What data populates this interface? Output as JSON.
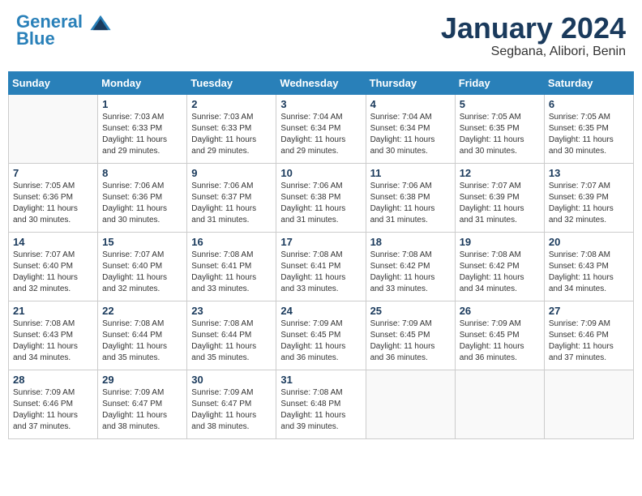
{
  "header": {
    "logo_line1": "General",
    "logo_line2": "Blue",
    "month": "January 2024",
    "location": "Segbana, Alibori, Benin"
  },
  "weekdays": [
    "Sunday",
    "Monday",
    "Tuesday",
    "Wednesday",
    "Thursday",
    "Friday",
    "Saturday"
  ],
  "weeks": [
    [
      {
        "day": "",
        "detail": ""
      },
      {
        "day": "1",
        "detail": "Sunrise: 7:03 AM\nSunset: 6:33 PM\nDaylight: 11 hours\nand 29 minutes."
      },
      {
        "day": "2",
        "detail": "Sunrise: 7:03 AM\nSunset: 6:33 PM\nDaylight: 11 hours\nand 29 minutes."
      },
      {
        "day": "3",
        "detail": "Sunrise: 7:04 AM\nSunset: 6:34 PM\nDaylight: 11 hours\nand 29 minutes."
      },
      {
        "day": "4",
        "detail": "Sunrise: 7:04 AM\nSunset: 6:34 PM\nDaylight: 11 hours\nand 30 minutes."
      },
      {
        "day": "5",
        "detail": "Sunrise: 7:05 AM\nSunset: 6:35 PM\nDaylight: 11 hours\nand 30 minutes."
      },
      {
        "day": "6",
        "detail": "Sunrise: 7:05 AM\nSunset: 6:35 PM\nDaylight: 11 hours\nand 30 minutes."
      }
    ],
    [
      {
        "day": "7",
        "detail": "Sunrise: 7:05 AM\nSunset: 6:36 PM\nDaylight: 11 hours\nand 30 minutes."
      },
      {
        "day": "8",
        "detail": "Sunrise: 7:06 AM\nSunset: 6:36 PM\nDaylight: 11 hours\nand 30 minutes."
      },
      {
        "day": "9",
        "detail": "Sunrise: 7:06 AM\nSunset: 6:37 PM\nDaylight: 11 hours\nand 31 minutes."
      },
      {
        "day": "10",
        "detail": "Sunrise: 7:06 AM\nSunset: 6:38 PM\nDaylight: 11 hours\nand 31 minutes."
      },
      {
        "day": "11",
        "detail": "Sunrise: 7:06 AM\nSunset: 6:38 PM\nDaylight: 11 hours\nand 31 minutes."
      },
      {
        "day": "12",
        "detail": "Sunrise: 7:07 AM\nSunset: 6:39 PM\nDaylight: 11 hours\nand 31 minutes."
      },
      {
        "day": "13",
        "detail": "Sunrise: 7:07 AM\nSunset: 6:39 PM\nDaylight: 11 hours\nand 32 minutes."
      }
    ],
    [
      {
        "day": "14",
        "detail": "Sunrise: 7:07 AM\nSunset: 6:40 PM\nDaylight: 11 hours\nand 32 minutes."
      },
      {
        "day": "15",
        "detail": "Sunrise: 7:07 AM\nSunset: 6:40 PM\nDaylight: 11 hours\nand 32 minutes."
      },
      {
        "day": "16",
        "detail": "Sunrise: 7:08 AM\nSunset: 6:41 PM\nDaylight: 11 hours\nand 33 minutes."
      },
      {
        "day": "17",
        "detail": "Sunrise: 7:08 AM\nSunset: 6:41 PM\nDaylight: 11 hours\nand 33 minutes."
      },
      {
        "day": "18",
        "detail": "Sunrise: 7:08 AM\nSunset: 6:42 PM\nDaylight: 11 hours\nand 33 minutes."
      },
      {
        "day": "19",
        "detail": "Sunrise: 7:08 AM\nSunset: 6:42 PM\nDaylight: 11 hours\nand 34 minutes."
      },
      {
        "day": "20",
        "detail": "Sunrise: 7:08 AM\nSunset: 6:43 PM\nDaylight: 11 hours\nand 34 minutes."
      }
    ],
    [
      {
        "day": "21",
        "detail": "Sunrise: 7:08 AM\nSunset: 6:43 PM\nDaylight: 11 hours\nand 34 minutes."
      },
      {
        "day": "22",
        "detail": "Sunrise: 7:08 AM\nSunset: 6:44 PM\nDaylight: 11 hours\nand 35 minutes."
      },
      {
        "day": "23",
        "detail": "Sunrise: 7:08 AM\nSunset: 6:44 PM\nDaylight: 11 hours\nand 35 minutes."
      },
      {
        "day": "24",
        "detail": "Sunrise: 7:09 AM\nSunset: 6:45 PM\nDaylight: 11 hours\nand 36 minutes."
      },
      {
        "day": "25",
        "detail": "Sunrise: 7:09 AM\nSunset: 6:45 PM\nDaylight: 11 hours\nand 36 minutes."
      },
      {
        "day": "26",
        "detail": "Sunrise: 7:09 AM\nSunset: 6:45 PM\nDaylight: 11 hours\nand 36 minutes."
      },
      {
        "day": "27",
        "detail": "Sunrise: 7:09 AM\nSunset: 6:46 PM\nDaylight: 11 hours\nand 37 minutes."
      }
    ],
    [
      {
        "day": "28",
        "detail": "Sunrise: 7:09 AM\nSunset: 6:46 PM\nDaylight: 11 hours\nand 37 minutes."
      },
      {
        "day": "29",
        "detail": "Sunrise: 7:09 AM\nSunset: 6:47 PM\nDaylight: 11 hours\nand 38 minutes."
      },
      {
        "day": "30",
        "detail": "Sunrise: 7:09 AM\nSunset: 6:47 PM\nDaylight: 11 hours\nand 38 minutes."
      },
      {
        "day": "31",
        "detail": "Sunrise: 7:08 AM\nSunset: 6:48 PM\nDaylight: 11 hours\nand 39 minutes."
      },
      {
        "day": "",
        "detail": ""
      },
      {
        "day": "",
        "detail": ""
      },
      {
        "day": "",
        "detail": ""
      }
    ]
  ]
}
